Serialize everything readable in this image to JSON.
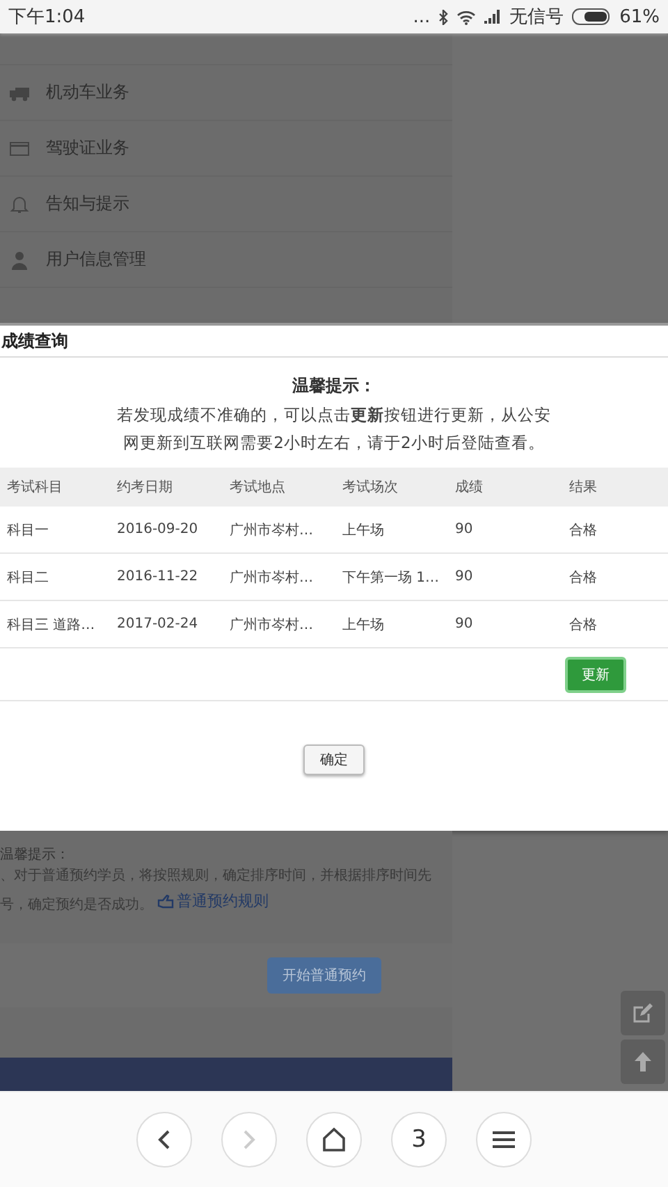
{
  "status_bar": {
    "time": "下午1:04",
    "dots": "...",
    "carrier": "无信号",
    "battery": "61%"
  },
  "menu": {
    "items": [
      {
        "kind": "truck",
        "label": "机动车业务"
      },
      {
        "kind": "card",
        "label": "驾驶证业务"
      },
      {
        "kind": "bell",
        "label": "告知与提示"
      },
      {
        "kind": "user",
        "label": "用户信息管理"
      }
    ]
  },
  "dialog": {
    "title": "成绩查询",
    "notice_title": "温馨提示：",
    "notice": "若发现成绩不准确的，可以点击**更新**按钮进行更新，从公安网更新到互联网需要2小时左右，请于2小时后登陆查看。",
    "table": {
      "columns": [
        "考试科目",
        "约考日期",
        "考试地点",
        "考试场次",
        "成绩",
        "结果"
      ],
      "rows": [
        [
          "科目一",
          "2016-09-20",
          "广州市岑村…",
          "上午场",
          "90",
          "合格"
        ],
        [
          "科目二",
          "2016-11-22",
          "广州市岑村…",
          "下午第一场 1…",
          "90",
          "合格"
        ],
        [
          "科目三 道路…",
          "2017-02-24",
          "广州市岑村…",
          "上午场",
          "90",
          "合格"
        ]
      ]
    },
    "update_button": "更新",
    "confirm_button": "确定"
  },
  "background": {
    "tip_title": "温馨提示：",
    "tip_lines": [
      "、对于普通预约学员，将按照规则，确定排序时间，并根据排序时间先",
      "号，确定预约是否成功。"
    ],
    "tip_link": "普通预约规则",
    "start_button": "开始普通预约"
  },
  "browser_bar": {
    "tab_count": "3"
  }
}
